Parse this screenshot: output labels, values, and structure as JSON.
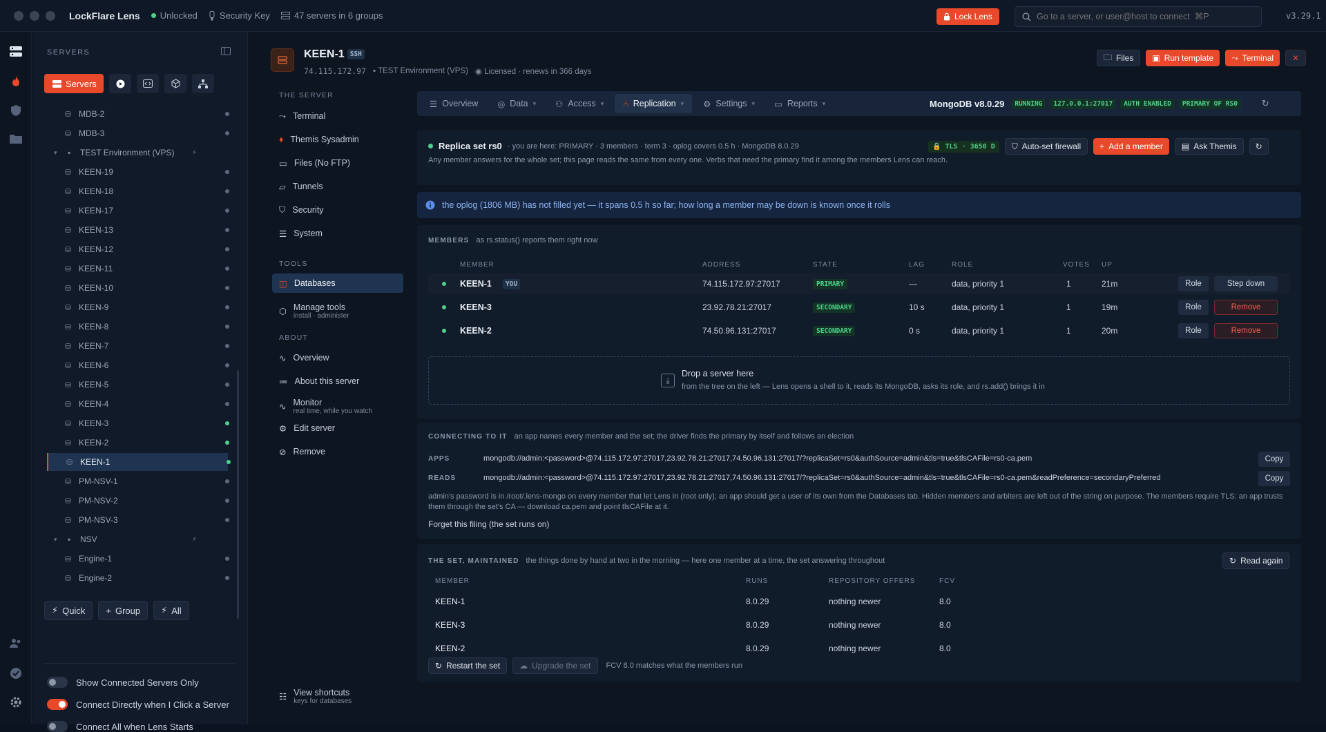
{
  "titlebar": {
    "app": "LockFlare Lens",
    "status": "Unlocked",
    "key": "Security Key",
    "servers": "47 servers in 6 groups",
    "lock_label": "Lock Lens",
    "search_placeholder": "Go to a server, or user@host to connect  ⌘P",
    "version": "v3.29.1"
  },
  "sidebar": {
    "title": "SERVERS",
    "servers_button": "Servers",
    "tree": [
      {
        "label": "MDB-2",
        "type": "server",
        "dot": "gray"
      },
      {
        "label": "MDB-3",
        "type": "server",
        "dot": "gray"
      },
      {
        "label": "TEST Environment (VPS)",
        "type": "group"
      },
      {
        "label": "KEEN-19",
        "type": "server",
        "dot": "gray"
      },
      {
        "label": "KEEN-18",
        "type": "server",
        "dot": "gray"
      },
      {
        "label": "KEEN-17",
        "type": "server",
        "dot": "gray"
      },
      {
        "label": "KEEN-13",
        "type": "server",
        "dot": "gray"
      },
      {
        "label": "KEEN-12",
        "type": "server",
        "dot": "gray"
      },
      {
        "label": "KEEN-11",
        "type": "server",
        "dot": "gray"
      },
      {
        "label": "KEEN-10",
        "type": "server",
        "dot": "gray"
      },
      {
        "label": "KEEN-9",
        "type": "server",
        "dot": "gray"
      },
      {
        "label": "KEEN-8",
        "type": "server",
        "dot": "gray"
      },
      {
        "label": "KEEN-7",
        "type": "server",
        "dot": "gray"
      },
      {
        "label": "KEEN-6",
        "type": "server",
        "dot": "gray"
      },
      {
        "label": "KEEN-5",
        "type": "server",
        "dot": "gray"
      },
      {
        "label": "KEEN-4",
        "type": "server",
        "dot": "gray"
      },
      {
        "label": "KEEN-3",
        "type": "server",
        "dot": "green"
      },
      {
        "label": "KEEN-2",
        "type": "server",
        "dot": "green"
      },
      {
        "label": "KEEN-1",
        "type": "server",
        "dot": "green",
        "selected": true
      },
      {
        "label": "PM-NSV-1",
        "type": "server",
        "dot": "gray"
      },
      {
        "label": "PM-NSV-2",
        "type": "server",
        "dot": "gray"
      },
      {
        "label": "PM-NSV-3",
        "type": "server",
        "dot": "gray"
      },
      {
        "label": "NSV",
        "type": "group"
      },
      {
        "label": "Engine-1",
        "type": "server",
        "dot": "gray"
      },
      {
        "label": "Engine-2",
        "type": "server",
        "dot": "gray"
      }
    ],
    "quick": "Quick",
    "group": "Group",
    "all": "All",
    "toggles": [
      {
        "label": "Show Connected Servers Only",
        "on": false
      },
      {
        "label": "Connect Directly when I Click a Server",
        "on": true
      },
      {
        "label": "Connect All when Lens Starts",
        "on": false
      }
    ]
  },
  "server": {
    "name": "KEEN-1",
    "proto": "SSH",
    "ip": "74.115.172.97",
    "env": "TEST Environment (VPS)",
    "license": "Licensed · renews in 366 days",
    "files": "Files",
    "run_template": "Run template",
    "terminal": "Terminal"
  },
  "snav": {
    "h_server": "THE SERVER",
    "h_tools": "TOOLS",
    "h_about": "ABOUT",
    "terminal": "Terminal",
    "themis": "Themis Sysadmin",
    "files": "Files (No FTP)",
    "tunnels": "Tunnels",
    "security": "Security",
    "system": "System",
    "databases": "Databases",
    "manage": "Manage tools",
    "manage_sub": "install · administer",
    "overview": "Overview",
    "about": "About this server",
    "monitor": "Monitor",
    "monitor_sub": "real time, while you watch",
    "edit": "Edit server",
    "remove": "Remove",
    "shortcuts": "View shortcuts",
    "shortcuts_sub": "keys for databases"
  },
  "tabs": {
    "overview": "Overview",
    "data": "Data",
    "access": "Access",
    "replication": "Replication",
    "settings": "Settings",
    "reports": "Reports"
  },
  "status": {
    "version": "MongoDB v8.0.29",
    "running": "RUNNING",
    "addr": "127.0.0.1:27017",
    "auth": "AUTH ENABLED",
    "primary": "PRIMARY OF RS0"
  },
  "rs": {
    "name": "Replica set rs0",
    "meta": "· you are here: PRIMARY · 3 members · term 3 · oplog covers 0.5 h · MongoDB 8.0.29",
    "desc": "Any member answers for the whole set; this page reads the same from every one. Verbs that need the primary find it among the members Lens can reach.",
    "tls": "TLS · 3650 D",
    "firewall": "Auto-set firewall",
    "add": "Add a member",
    "ask": "Ask Themis"
  },
  "info": "the oplog (1806 MB) has not filled yet — it spans 0.5 h so far; how long a member may be down is known once it rolls",
  "members": {
    "title": "MEMBERS",
    "sub": "as rs.status() reports them right now",
    "headers": {
      "member": "MEMBER",
      "address": "ADDRESS",
      "state": "STATE",
      "lag": "LAG",
      "role": "ROLE",
      "votes": "VOTES",
      "up": "UP"
    },
    "rows": [
      {
        "member": "KEEN-1",
        "you": "YOU",
        "address": "74.115.172.97:27017",
        "state": "PRIMARY",
        "lag": "—",
        "role": "data, priority 1",
        "votes": "1",
        "up": "21m",
        "btn1": "Role",
        "btn2": "Step down"
      },
      {
        "member": "KEEN-3",
        "address": "23.92.78.21:27017",
        "state": "SECONDARY",
        "lag": "10 s",
        "role": "data, priority 1",
        "votes": "1",
        "up": "19m",
        "btn1": "Role",
        "btn2": "Remove"
      },
      {
        "member": "KEEN-2",
        "address": "74.50.96.131:27017",
        "state": "SECONDARY",
        "lag": "0 s",
        "role": "data, priority 1",
        "votes": "1",
        "up": "20m",
        "btn1": "Role",
        "btn2": "Remove"
      }
    ],
    "drop_title": "Drop a server here",
    "drop_sub": "from the tree on the left — Lens opens a shell to it, reads its MongoDB, asks its role, and rs.add() brings it in"
  },
  "connect": {
    "title": "CONNECTING TO IT",
    "sub": "an app names every member and the set; the driver finds the primary by itself and follows an election",
    "apps_label": "APPS",
    "apps_uri": "mongodb://admin:<password>@74.115.172.97:27017,23.92.78.21:27017,74.50.96.131:27017/?replicaSet=rs0&authSource=admin&tls=true&tlsCAFile=rs0-ca.pem",
    "reads_label": "READS",
    "reads_uri": "mongodb://admin:<password>@74.115.172.97:27017,23.92.78.21:27017,74.50.96.131:27017/?replicaSet=rs0&authSource=admin&tls=true&tlsCAFile=rs0-ca.pem&readPreference=secondaryPreferred",
    "copy": "Copy",
    "note": "admin's password is in /root/.lens-mongo on every member that let Lens in (root only); an app should get a user of its own from the Databases tab. Hidden members and arbiters are left out of the string on purpose. The members require TLS: an app trusts them through the set's CA — download ca.pem and point tlsCAFile at it.",
    "forget": "Forget this filing (the set runs on)"
  },
  "maint": {
    "title": "THE SET, MAINTAINED",
    "sub": "the things done by hand at two in the morning — here one member at a time, the set answering throughout",
    "read_again": "Read again",
    "headers": {
      "member": "MEMBER",
      "runs": "RUNS",
      "offers": "REPOSITORY OFFERS",
      "fcv": "FCV"
    },
    "rows": [
      {
        "member": "KEEN-1",
        "runs": "8.0.29",
        "offers": "nothing newer",
        "fcv": "8.0"
      },
      {
        "member": "KEEN-3",
        "runs": "8.0.29",
        "offers": "nothing newer",
        "fcv": "8.0"
      },
      {
        "member": "KEEN-2",
        "runs": "8.0.29",
        "offers": "nothing newer",
        "fcv": "8.0"
      }
    ],
    "restart": "Restart the set",
    "upgrade": "Upgrade the set",
    "fcv_note": "FCV 8.0 matches what the members run"
  },
  "colors": {
    "accent": "#e8492a",
    "green": "#4fd18b",
    "bg": "#0d1521",
    "info": "#8fb4ee"
  }
}
